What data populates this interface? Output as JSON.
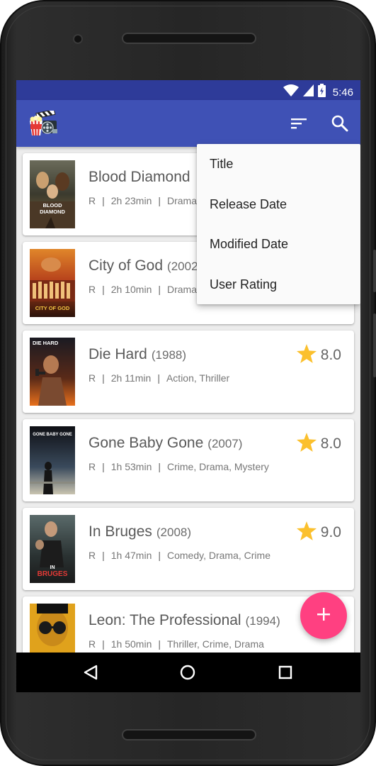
{
  "status_bar": {
    "time": "5:46",
    "icons": [
      "wifi-icon",
      "signal-icon",
      "battery-charging-icon"
    ]
  },
  "app_bar": {
    "logo": "movie-logo-icon",
    "actions": [
      "sort-icon",
      "search-icon"
    ]
  },
  "sort_menu": {
    "items": [
      "Title",
      "Release Date",
      "Modified Date",
      "User Rating"
    ]
  },
  "movies": [
    {
      "title": "Blood Diamond",
      "year": "",
      "rating_mpaa": "R",
      "runtime": "2h 23min",
      "genres": "Drama",
      "user_rating": ""
    },
    {
      "title": "City of God",
      "year": "(2002",
      "rating_mpaa": "R",
      "runtime": "2h 10min",
      "genres": "Drama",
      "user_rating": ""
    },
    {
      "title": "Die Hard",
      "year": "(1988)",
      "rating_mpaa": "R",
      "runtime": "2h 11min",
      "genres": "Action, Thriller",
      "user_rating": "8.0"
    },
    {
      "title": "Gone Baby Gone",
      "year": "(2007)",
      "rating_mpaa": "R",
      "runtime": "1h 53min",
      "genres": "Crime, Drama, Mystery",
      "user_rating": "8.0"
    },
    {
      "title": "In Bruges",
      "year": "(2008)",
      "rating_mpaa": "R",
      "runtime": "1h 47min",
      "genres": "Comedy, Drama, Crime",
      "user_rating": "9.0"
    },
    {
      "title": "Leon: The Professional",
      "year": "(1994)",
      "rating_mpaa": "R",
      "runtime": "1h 50min",
      "genres": "Thriller, Crime, Drama",
      "user_rating": ""
    }
  ],
  "posters": [
    {
      "caption_line1": "BLOOD",
      "caption_line2": "DIAMOND"
    },
    {
      "caption_line1": "CITY OF GOD",
      "caption_line2": ""
    },
    {
      "caption_line1": "DIE HARD",
      "caption_line2": ""
    },
    {
      "caption_line1": "GONE BABY GONE",
      "caption_line2": ""
    },
    {
      "caption_line1": "IN",
      "caption_line2": "BRUGES"
    },
    {
      "caption_line1": "",
      "caption_line2": ""
    }
  ],
  "fab": {
    "icon": "add-icon",
    "label": "+"
  },
  "colors": {
    "primary": "#3f51b5",
    "primary_dark": "#2e3b99",
    "accent": "#ff4081",
    "star": "#fbc02d"
  },
  "nav_bar": {
    "icons": [
      "back-icon",
      "home-icon",
      "recent-apps-icon"
    ]
  }
}
